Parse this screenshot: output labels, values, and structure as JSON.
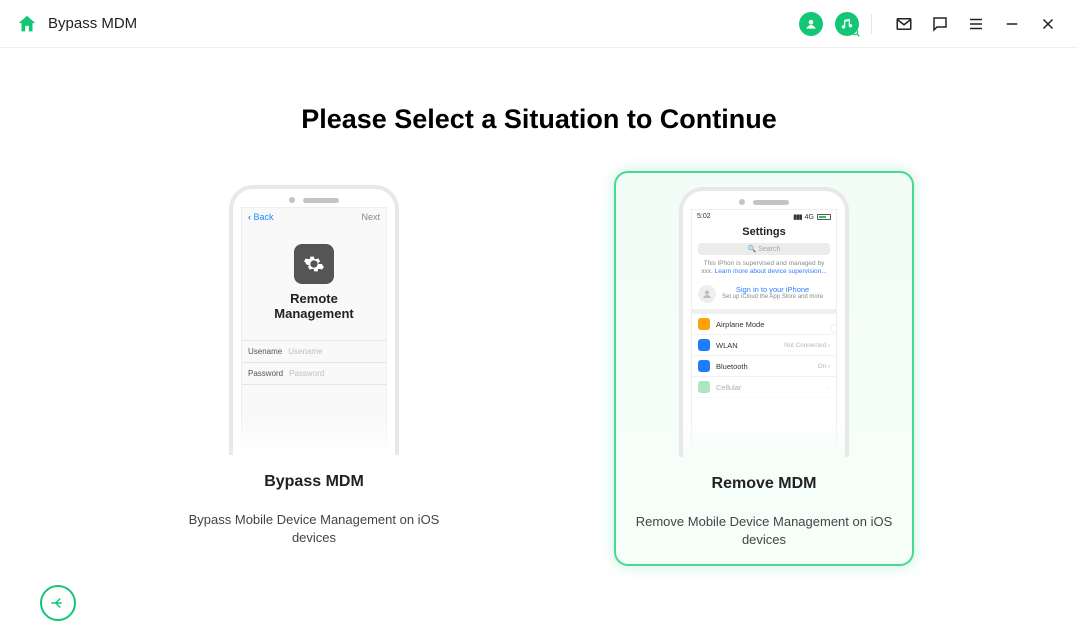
{
  "header": {
    "title": "Bypass MDM"
  },
  "main": {
    "page_title": "Please Select a Situation to Continue"
  },
  "options": {
    "bypass": {
      "title": "Bypass MDM",
      "desc": "Bypass Mobile Device Management on iOS devices",
      "phone": {
        "back": "Back",
        "next": "Next",
        "screen_title": "Remote Management",
        "username_label": "Usename",
        "username_placeholder": "Usename",
        "password_label": "Password",
        "password_placeholder": "Password"
      }
    },
    "remove": {
      "title": "Remove MDM",
      "desc": "Remove Mobile Device Management on iOS devices",
      "phone": {
        "time": "5:02",
        "signal": "4G",
        "title": "Settings",
        "search_placeholder": "Search",
        "supervised_note_pre": "This iPhon is supervised and managed by xxx. ",
        "supervised_note_link": "Learn more about device supervision...",
        "signin_title": "Sign in to your iPhone",
        "signin_sub": "Set up iCloud the App Store and more",
        "rows": {
          "airplane": "Airplane Mode",
          "wlan": "WLAN",
          "wlan_status": "Not Connected",
          "bluetooth": "Bluetooth",
          "bluetooth_status": "On",
          "cellular": "Cellular"
        }
      }
    }
  }
}
